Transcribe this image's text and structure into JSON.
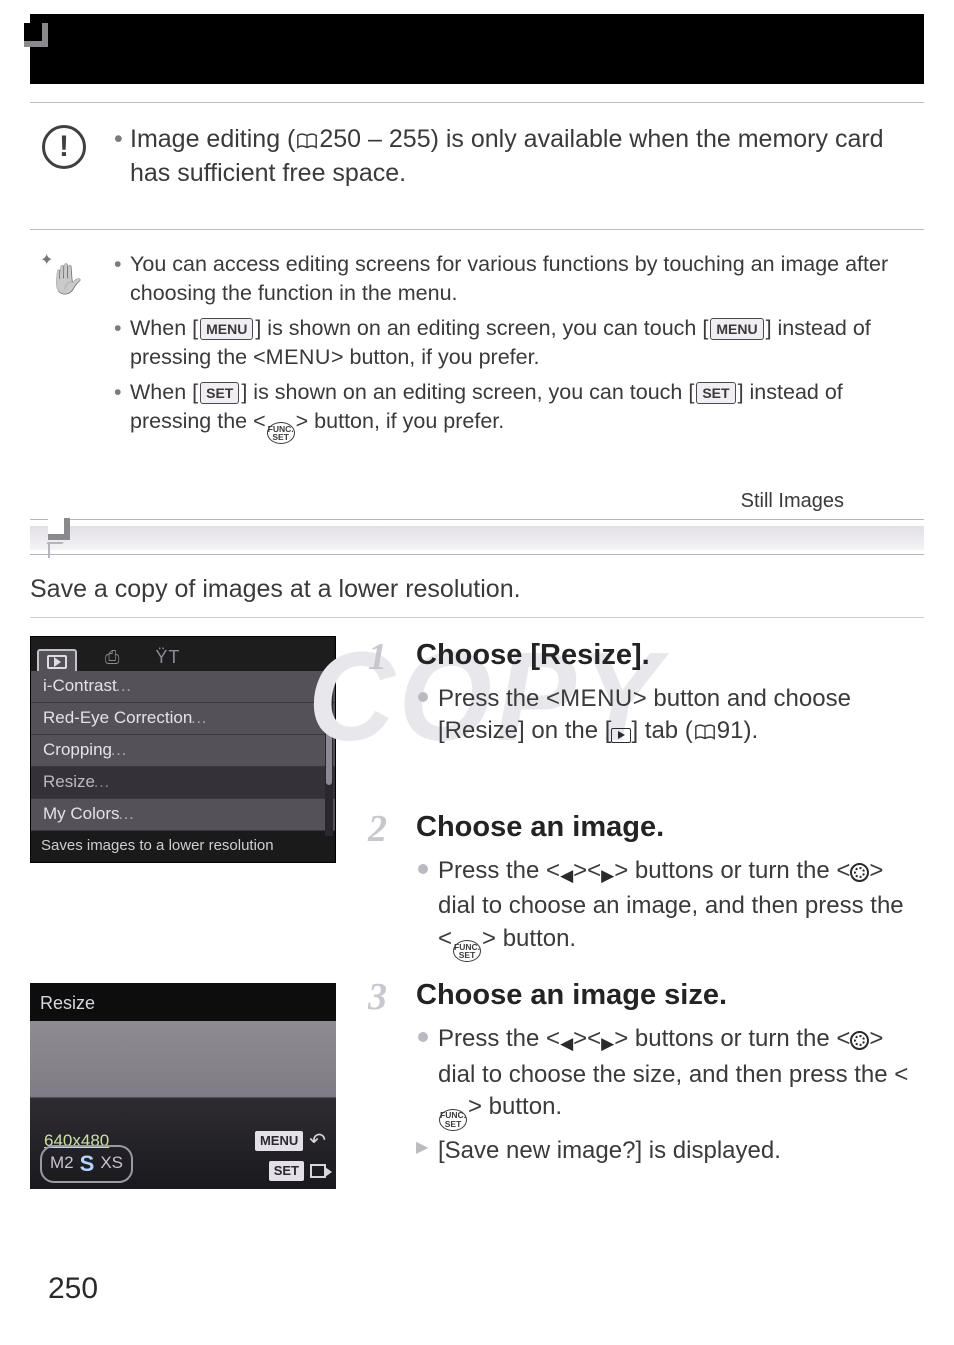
{
  "warning": {
    "text_a": "Image editing (",
    "text_b": "250 – 255) is only available when the memory card has sufficient free space."
  },
  "tips": {
    "item1": "You can access editing screens for various functions by touching an image after choosing the function in the menu.",
    "item2_a": "When [",
    "item2_b": "] is shown on an editing screen, you can touch [",
    "item2_c": "] instead of pressing the <",
    "item2_d": "> button, if you prefer.",
    "item3_a": "When [",
    "item3_b": "] is shown on an editing screen, you can touch [",
    "item3_c": "] instead of pressing the <",
    "item3_d": "> button, if you prefer.",
    "menu_small": "MENU",
    "set_small": "SET",
    "menu_big": "MENU",
    "func_top": "FUNC.",
    "func_bot": "SET"
  },
  "tag": "Still Images",
  "lead": "Save a copy of images at a lower resolution.",
  "menu": {
    "rows": [
      "i-Contrast",
      "Red-Eye Correction",
      "Cropping",
      "Resize",
      "My Colors"
    ],
    "footer": "Saves images to a lower resolution"
  },
  "watermark": "COPY",
  "steps": {
    "s1": {
      "num": "1",
      "title": "Choose [Resize].",
      "bul_a": "Press the <",
      "bul_b": "> button and choose [Resize] on the [",
      "bul_c": "] tab (",
      "bul_d": "91).",
      "menu": "MENU"
    },
    "s2": {
      "num": "2",
      "title": "Choose an image.",
      "bul_a": "Press the <",
      "bul_b": "><",
      "bul_c": "> buttons or turn the <",
      "bul_d": "> dial to choose an image, and then press the <",
      "bul_e": "> button."
    },
    "s3": {
      "num": "3",
      "title": "Choose an image size.",
      "bul_a": "Press the <",
      "bul_b": "><",
      "bul_c": "> buttons or turn the <",
      "bul_d": "> dial to choose the size, and then press the <",
      "bul_e": "> button.",
      "arrow": "[Save new image?] is displayed."
    }
  },
  "resize": {
    "title": "Resize",
    "dim": "640x480",
    "sizes": [
      "M2",
      "S",
      "XS"
    ],
    "menuLbl": "MENU",
    "setLbl": "SET"
  },
  "page": "250"
}
